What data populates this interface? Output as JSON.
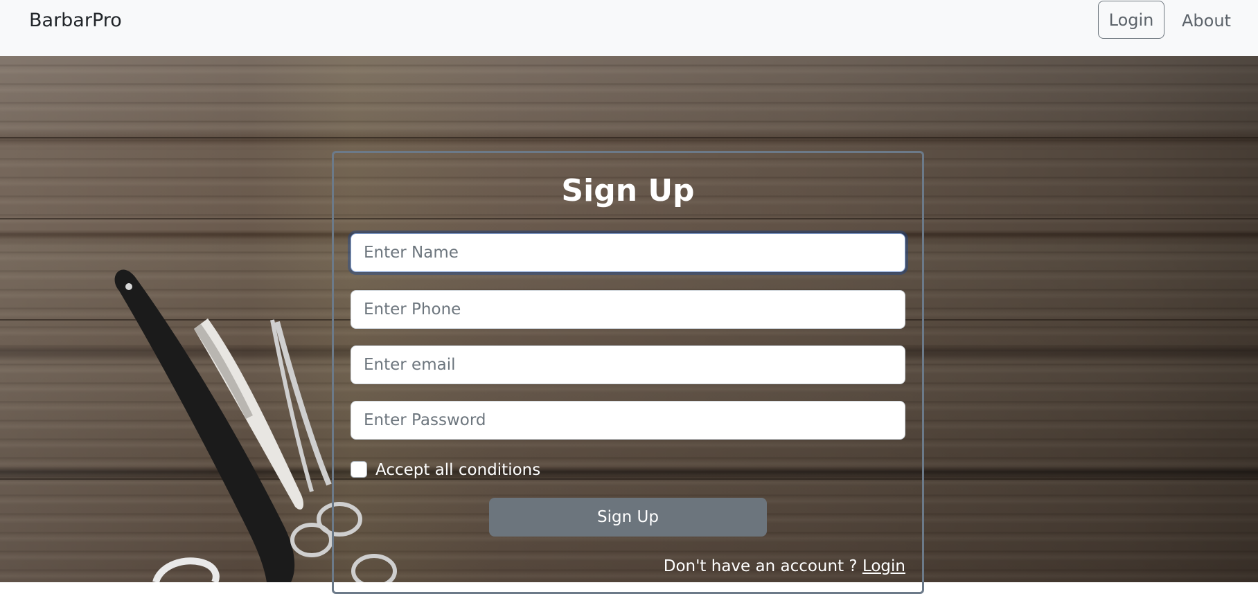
{
  "navbar": {
    "brand": "BarbarPro",
    "login_label": "Login",
    "about_label": "About"
  },
  "form": {
    "title": "Sign Up",
    "name_placeholder": "Enter Name",
    "phone_placeholder": "Enter Phone",
    "email_placeholder": "Enter email",
    "password_placeholder": "Enter Password",
    "accept_label": "Accept all conditions",
    "accept_checked": false,
    "submit_label": "Sign Up",
    "footer_text": "Don't have an account ?",
    "footer_link": "Login"
  },
  "colors": {
    "navbar_bg": "#f8f9fa",
    "button_secondary": "#6c757d",
    "card_border": "#6c7a89",
    "focus_ring": "#86a4d6"
  },
  "background": {
    "description_icons": [
      "straight-razor-icon",
      "razor-icon",
      "scissors-icon"
    ]
  }
}
